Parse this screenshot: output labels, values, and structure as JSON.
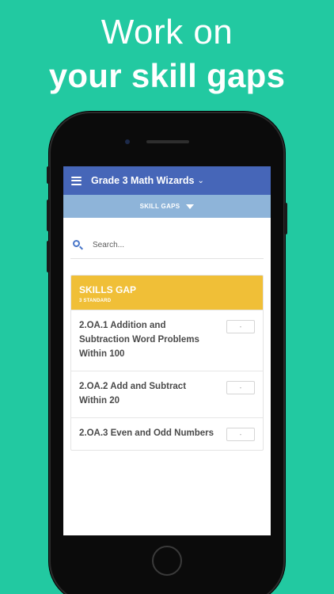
{
  "headline": {
    "line1": "Work on",
    "line2": "your skill gaps"
  },
  "app": {
    "title": "Grade 3 Math Wizards",
    "title_chevron": "⌄",
    "subbar_label": "SKILL GAPS"
  },
  "search": {
    "placeholder": "Search..."
  },
  "card": {
    "title": "SKILLS GAP",
    "subtitle": "3 STANDARD",
    "items": [
      {
        "label": "2.OA.1 Addition and Subtraction Word Problems Within 100",
        "value": "-"
      },
      {
        "label": "2.OA.2 Add and Subtract Within 20",
        "value": "-"
      },
      {
        "label": "2.OA.3 Even and Odd Numbers",
        "value": "-"
      }
    ]
  },
  "colors": {
    "background": "#22c9a1",
    "appbar": "#4666b8",
    "subbar": "#8eb4d9",
    "card_header": "#f0bf37",
    "search_icon": "#4a77c9"
  }
}
